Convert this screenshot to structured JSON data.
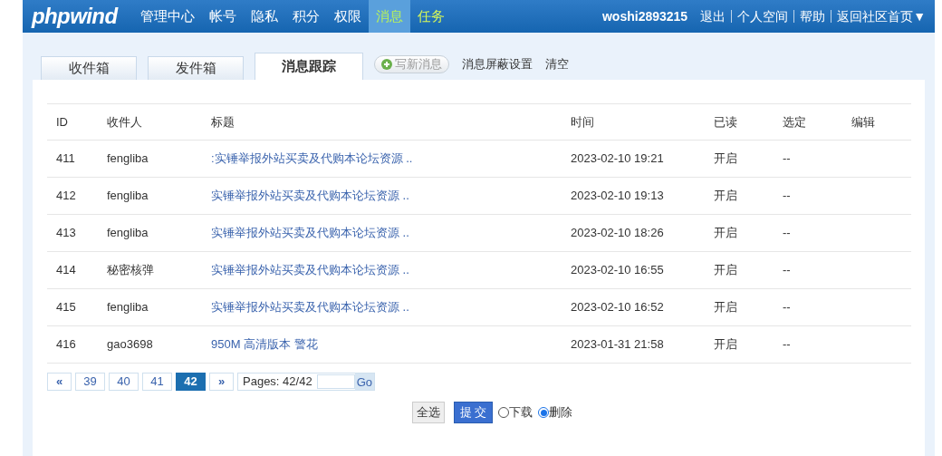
{
  "header": {
    "logo": "phpwind",
    "nav": [
      {
        "label": "管理中心",
        "selected": false,
        "highlighted": false
      },
      {
        "label": "帐号",
        "selected": false,
        "highlighted": false
      },
      {
        "label": "隐私",
        "selected": false,
        "highlighted": false
      },
      {
        "label": "积分",
        "selected": false,
        "highlighted": false
      },
      {
        "label": "权限",
        "selected": false,
        "highlighted": false
      },
      {
        "label": "消息",
        "selected": true,
        "highlighted": false
      },
      {
        "label": "任务",
        "selected": false,
        "highlighted": true
      }
    ],
    "user": "woshi2893215",
    "links": [
      "退出",
      "个人空间",
      "帮助",
      "返回社区首页▼"
    ]
  },
  "tabs": [
    {
      "label": "收件箱",
      "selected": false
    },
    {
      "label": "发件箱",
      "selected": false
    },
    {
      "label": "消息跟踪",
      "selected": true
    }
  ],
  "compose_button": "写新消息",
  "tab_links": [
    "消息屏蔽设置",
    "清空"
  ],
  "table": {
    "columns": [
      "ID",
      "收件人",
      "标题",
      "时间",
      "已读",
      "选定",
      "编辑"
    ],
    "rows": [
      {
        "id": "411",
        "recipient": "fengliba",
        "title": ":实锤举报外站买卖及代购本论坛资源 ..",
        "time": "2023-02-10 19:21",
        "read": "开启",
        "select": "--"
      },
      {
        "id": "412",
        "recipient": "fengliba",
        "title": "实锤举报外站买卖及代购本论坛资源 ..",
        "time": "2023-02-10 19:13",
        "read": "开启",
        "select": "--"
      },
      {
        "id": "413",
        "recipient": "fengliba",
        "title": "实锤举报外站买卖及代购本论坛资源 ..",
        "time": "2023-02-10 18:26",
        "read": "开启",
        "select": "--"
      },
      {
        "id": "414",
        "recipient": "秘密核弹",
        "title": "实锤举报外站买卖及代购本论坛资源 ..",
        "time": "2023-02-10 16:55",
        "read": "开启",
        "select": "--"
      },
      {
        "id": "415",
        "recipient": "fengliba",
        "title": "实锤举报外站买卖及代购本论坛资源 ..",
        "time": "2023-02-10 16:52",
        "read": "开启",
        "select": "--"
      },
      {
        "id": "416",
        "recipient": "gao3698",
        "title": "950M 高清版本 警花",
        "time": "2023-01-31 21:58",
        "read": "开启",
        "select": "--"
      }
    ]
  },
  "pagination": {
    "first": "«",
    "pages": [
      {
        "label": "39",
        "selected": false
      },
      {
        "label": "40",
        "selected": false
      },
      {
        "label": "41",
        "selected": false
      },
      {
        "label": "42",
        "selected": true
      }
    ],
    "next": "»",
    "info": "Pages: 42/42",
    "go": "Go"
  },
  "actions": {
    "select_all": "全选",
    "submit": "提 交",
    "options": [
      {
        "label": "下载",
        "selected": false
      },
      {
        "label": "删除",
        "selected": true
      }
    ]
  }
}
